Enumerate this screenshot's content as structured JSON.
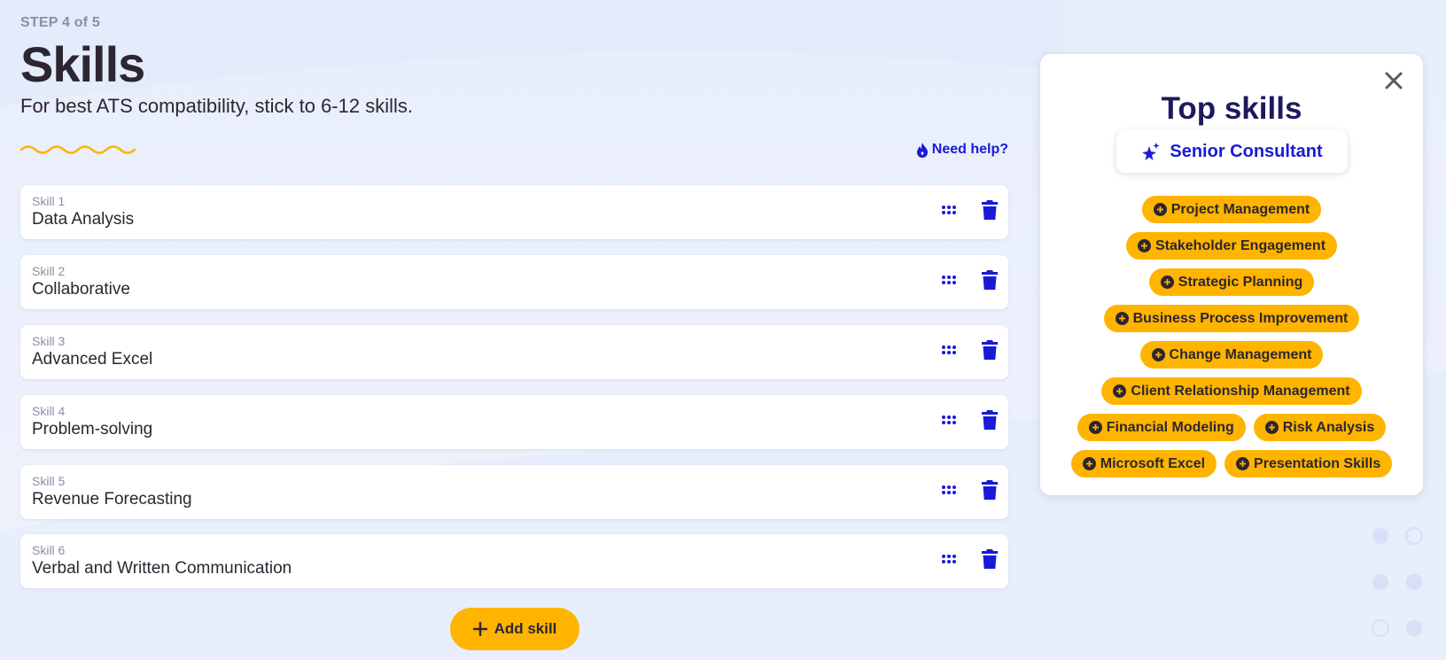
{
  "header": {
    "step": "STEP 4 of 5",
    "title": "Skills",
    "subtitle": "For best ATS compatibility, stick to 6-12 skills.",
    "help_label": "Need help?"
  },
  "skills": [
    {
      "label": "Skill 1",
      "value": "Data Analysis"
    },
    {
      "label": "Skill 2",
      "value": "Collaborative"
    },
    {
      "label": "Skill 3",
      "value": "Advanced Excel"
    },
    {
      "label": "Skill 4",
      "value": "Problem-solving"
    },
    {
      "label": "Skill 5",
      "value": "Revenue Forecasting"
    },
    {
      "label": "Skill 6",
      "value": "Verbal and Written Communication"
    }
  ],
  "add_skill_label": "Add skill",
  "panel": {
    "title": "Top skills",
    "role": "Senior Consultant",
    "suggestions": [
      [
        "Project Management"
      ],
      [
        "Stakeholder Engagement"
      ],
      [
        "Strategic Planning"
      ],
      [
        "Business Process Improvement"
      ],
      [
        "Change Management"
      ],
      [
        "Client Relationship Management"
      ],
      [
        "Financial Modeling",
        "Risk Analysis"
      ],
      [
        "Microsoft Excel",
        "Presentation Skills"
      ]
    ]
  },
  "icons": {
    "drag": "drag-handle-icon",
    "delete": "trash-icon",
    "help": "flame-icon",
    "close": "close-icon",
    "role": "sparkle-star-icon",
    "add": "plus-icon",
    "suggest": "plus-circle-icon"
  },
  "colors": {
    "accent": "#1a1ad6",
    "pill": "#ffb400",
    "title_dark": "#1d1a5c"
  }
}
